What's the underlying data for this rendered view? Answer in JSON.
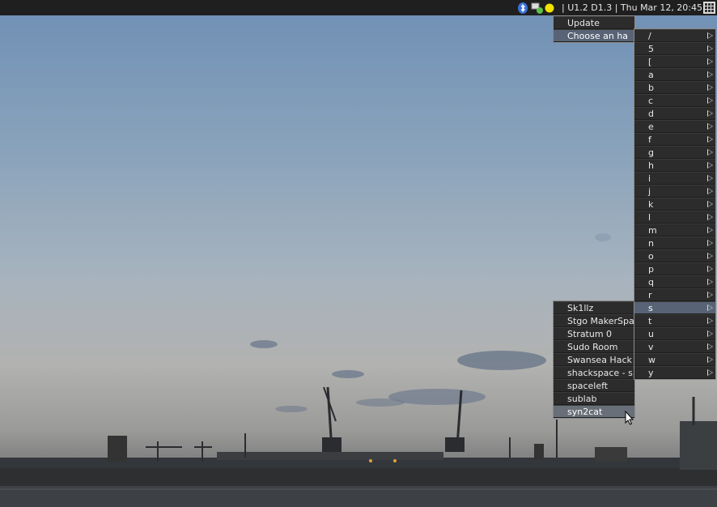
{
  "taskbar": {
    "status_text": "| U1.2 D1.3 | Thu Mar 12, 20:45",
    "icons": [
      "bluetooth-icon",
      "network-icon",
      "status-icon",
      "launcher-grid-icon"
    ]
  },
  "main_menu": {
    "items": [
      {
        "label": "Update"
      },
      {
        "label": "Choose an ha"
      }
    ]
  },
  "alpha_menu": {
    "items": [
      {
        "label": "/"
      },
      {
        "label": "5"
      },
      {
        "label": "["
      },
      {
        "label": "a"
      },
      {
        "label": "b"
      },
      {
        "label": "c"
      },
      {
        "label": "d"
      },
      {
        "label": "e"
      },
      {
        "label": "f"
      },
      {
        "label": "g"
      },
      {
        "label": "h"
      },
      {
        "label": "i"
      },
      {
        "label": "j"
      },
      {
        "label": "k"
      },
      {
        "label": "l"
      },
      {
        "label": "m"
      },
      {
        "label": "n"
      },
      {
        "label": "o"
      },
      {
        "label": "p"
      },
      {
        "label": "q"
      },
      {
        "label": "r"
      },
      {
        "label": "s"
      },
      {
        "label": "t"
      },
      {
        "label": "u"
      },
      {
        "label": "v"
      },
      {
        "label": "w"
      },
      {
        "label": "y"
      }
    ]
  },
  "s_menu": {
    "items": [
      {
        "label": "Sk1llz"
      },
      {
        "label": "Stgo MakerSpa"
      },
      {
        "label": "Stratum 0"
      },
      {
        "label": "Sudo Room"
      },
      {
        "label": "Swansea Hack"
      },
      {
        "label": "shackspace - s"
      },
      {
        "label": "spaceleft"
      },
      {
        "label": "sublab"
      },
      {
        "label": "syn2cat"
      }
    ]
  }
}
